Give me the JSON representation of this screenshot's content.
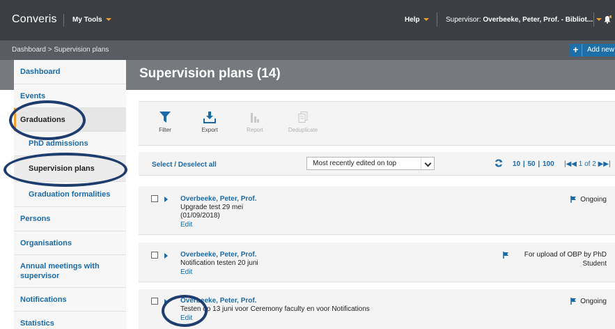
{
  "topbar": {
    "logo": "Converis",
    "my_tools": "My Tools",
    "help": "Help",
    "supervisor_prefix": "Supervisor: ",
    "supervisor_name": "Overbeeke, Peter, Prof. - Bibliot..."
  },
  "breadcrumb": "Dashboard > Supervision plans",
  "add_new": "Add new",
  "sidebar": {
    "items": [
      {
        "label": "Dashboard"
      },
      {
        "label": "Events"
      },
      {
        "label": "Graduations"
      },
      {
        "label": "PhD admissions"
      },
      {
        "label": "Supervision plans"
      },
      {
        "label": "Graduation formalities"
      },
      {
        "label": "Persons"
      },
      {
        "label": "Organisations"
      },
      {
        "label": "Annual meetings with supervisor"
      },
      {
        "label": "Notifications"
      },
      {
        "label": "Statistics"
      }
    ]
  },
  "page_title": "Supervision plans (14)",
  "toolbar": {
    "filter": "Filter",
    "export": "Export",
    "report": "Report",
    "deduplicate": "Deduplicate"
  },
  "list": {
    "select_all": "Select / Deselect all",
    "sort_value": "Most recently edited on top",
    "page_sizes": "10 | 50 | 100",
    "pager": "1 of 2"
  },
  "records": [
    {
      "name": "Overbeeke, Peter, Prof.",
      "line1": "Upgrade test 29 mei",
      "line2": "(01/09/2018)",
      "edit": "Edit",
      "status_line1": "Ongoing",
      "status_line2": ""
    },
    {
      "name": "Overbeeke, Peter, Prof.",
      "line1": "Notification testen 20 juni",
      "line2": "",
      "edit": "Edit",
      "status_line1": "For upload of OBP by PhD",
      "status_line2": "Student"
    },
    {
      "name": "Overbeeke, Peter, Prof.",
      "line1": "Testen op 13 juni voor Ceremony faculty en voor Notifications",
      "line2": "",
      "edit": "Edit",
      "status_line1": "Ongoing",
      "status_line2": ""
    }
  ],
  "colors": {
    "topbar": "#3b3f44",
    "link": "#1a6aa8",
    "accent": "#f0a030",
    "annotation": "#1e3d6e"
  }
}
